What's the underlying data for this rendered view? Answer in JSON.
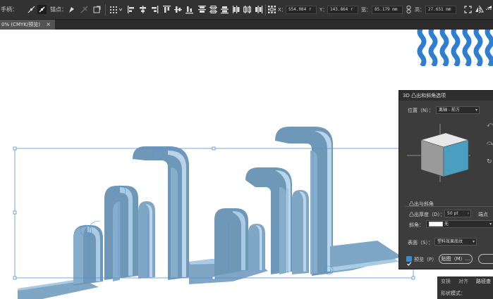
{
  "toolbar": {
    "handle_label": "手柄：",
    "anchor_label": "锚点：",
    "x_label": "X：",
    "x_value": "554.084 r",
    "y_label": "Y：",
    "y_value": "143.864 r",
    "w_label": "宽：",
    "w_value": "85.179 mm",
    "h_label": "高：",
    "h_value": "27.651 mm"
  },
  "document_tab": {
    "title": "0% (CMYK/预览)",
    "close": "×"
  },
  "dialog_3d": {
    "title": "3D 凸出和斜角选项",
    "position_label": "位置（N）：",
    "position_value": "离轴 - 前方",
    "extrude_section": "凸出与斜角",
    "depth_label": "凸出厚度（D）：",
    "depth_value": "50 pt",
    "cap_label": "端点",
    "bevel_label": "斜角：",
    "bevel_value": "无",
    "surface_label": "表面（S）：",
    "surface_value": "塑料效果底纹",
    "preview_label": "预览（P）",
    "map_button": "贴图（M）..."
  },
  "panel_tabs": {
    "tab1": "变换",
    "tab2": "对齐",
    "tab3": "路径查",
    "shape_mode": "形状模式："
  },
  "colors": {
    "toolbar_bg": "#323232",
    "dialog_bg": "#3c3c3c",
    "shape_fill": "#7fa6c5",
    "shape_light": "#a9cbe3",
    "selection_blue": "#5b8fd6",
    "wave_blue": "#2f7fd1",
    "cube_face": "#4a9fc0"
  }
}
